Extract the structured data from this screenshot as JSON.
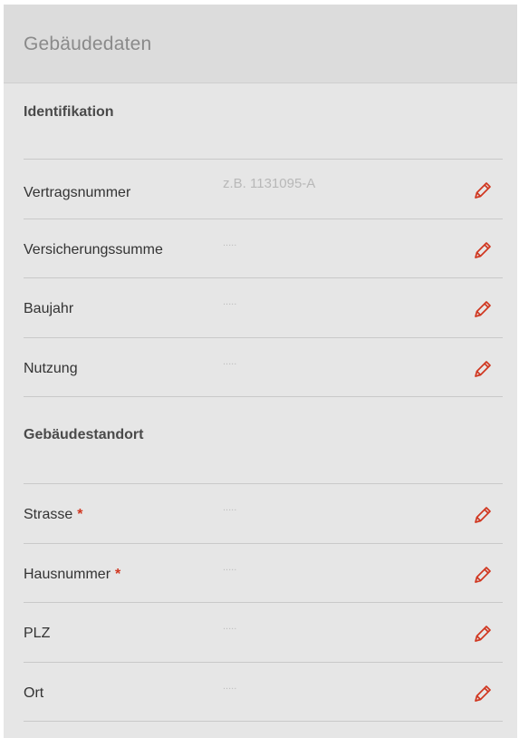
{
  "panel": {
    "title": "Gebäudedaten"
  },
  "sections": [
    {
      "heading": "Identifikation",
      "fields": [
        {
          "label": "Vertragsnummer",
          "value": "z.B. 1131095-A",
          "required": false
        },
        {
          "label": "Versicherungssumme",
          "value": ".....",
          "required": false
        },
        {
          "label": "Baujahr",
          "value": ".....",
          "required": false
        },
        {
          "label": "Nutzung",
          "value": ".....",
          "required": false
        }
      ]
    },
    {
      "heading": "Gebäudestandort",
      "fields": [
        {
          "label": "Strasse",
          "value": ".....",
          "required": true
        },
        {
          "label": "Hausnummer",
          "value": ".....",
          "required": true
        },
        {
          "label": "PLZ",
          "value": ".....",
          "required": false
        },
        {
          "label": "Ort",
          "value": ".....",
          "required": false
        }
      ]
    }
  ],
  "required_marker": "*",
  "icons": {
    "edit": "pencil-icon"
  },
  "colors": {
    "accent": "#d0361f",
    "panel_bg": "#e6e6e6",
    "header_bg": "#dcdcdc"
  }
}
